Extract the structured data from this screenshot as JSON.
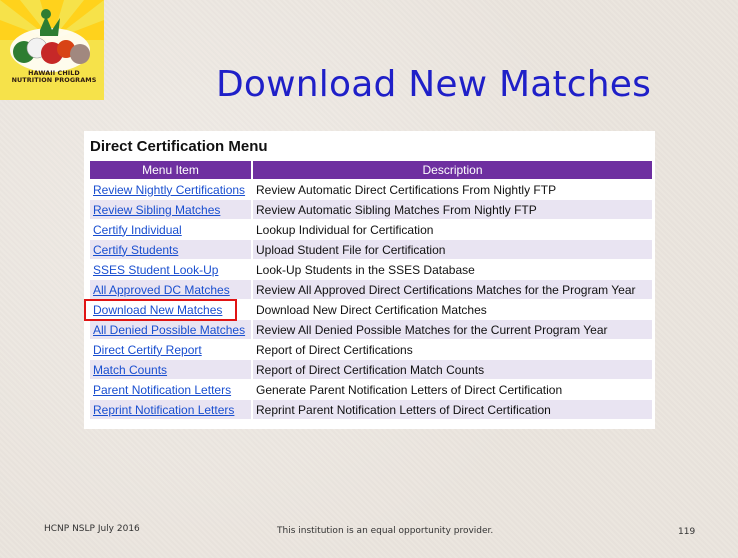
{
  "logo": {
    "line1": "HAWAII CHILD",
    "line2": "NUTRITION PROGRAMS"
  },
  "title": "Download New Matches",
  "menu": {
    "title": "Direct Certification Menu",
    "headers": {
      "item": "Menu Item",
      "description": "Description"
    },
    "rows": [
      {
        "item": "Review Nightly Certifications",
        "description": "Review Automatic Direct Certifications From Nightly FTP"
      },
      {
        "item": "Review Sibling Matches",
        "description": "Review Automatic Sibling Matches From Nightly FTP"
      },
      {
        "item": "Certify Individual",
        "description": "Lookup Individual for Certification"
      },
      {
        "item": "Certify Students",
        "description": "Upload Student File for Certification"
      },
      {
        "item": "SSES Student Look-Up",
        "description": "Look-Up Students in the SSES Database"
      },
      {
        "item": "All Approved DC Matches",
        "description": "Review All Approved Direct Certifications Matches for the Program Year"
      },
      {
        "item": "Download New Matches",
        "description": "Download New Direct Certification Matches"
      },
      {
        "item": "All Denied Possible Matches",
        "description": "Review All Denied Possible Matches for the Current Program Year"
      },
      {
        "item": "Direct Certify Report",
        "description": "Report of Direct Certifications"
      },
      {
        "item": "Match Counts",
        "description": "Report of Direct Certification Match Counts"
      },
      {
        "item": "Parent Notification Letters",
        "description": "Generate Parent Notification Letters of Direct Certification"
      },
      {
        "item": "Reprint Notification Letters",
        "description": "Reprint Parent Notification Letters of Direct Certification"
      }
    ]
  },
  "footer": {
    "left": "HCNP NSLP July 2016",
    "center": "This institution is an equal opportunity provider.",
    "page": "119"
  },
  "colors": {
    "title": "#1f1fc8",
    "header": "#6e2fa0",
    "highlight": "#e01414",
    "link": "#1a4fd0"
  }
}
